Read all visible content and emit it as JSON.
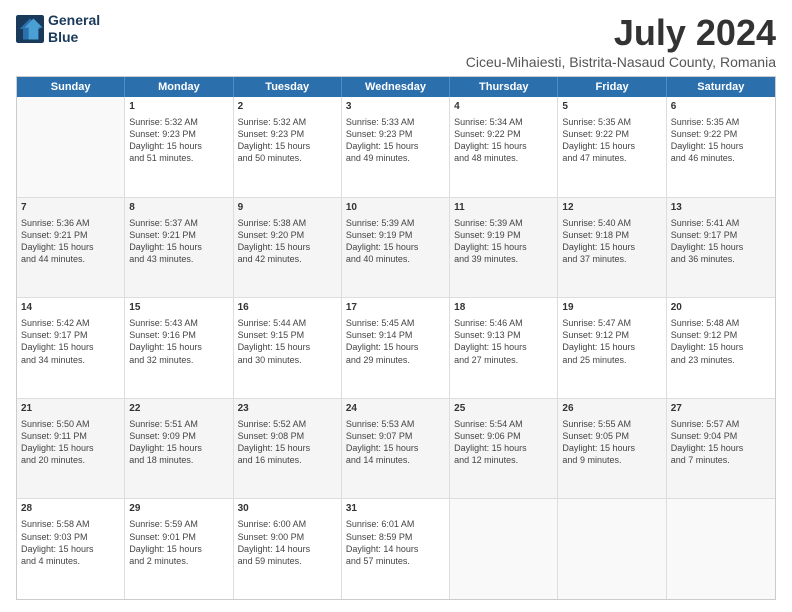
{
  "header": {
    "logo_line1": "General",
    "logo_line2": "Blue",
    "main_title": "July 2024",
    "subtitle": "Ciceu-Mihaiesti, Bistrita-Nasaud County, Romania"
  },
  "weekdays": [
    "Sunday",
    "Monday",
    "Tuesday",
    "Wednesday",
    "Thursday",
    "Friday",
    "Saturday"
  ],
  "rows": [
    [
      {
        "day": "",
        "lines": []
      },
      {
        "day": "1",
        "lines": [
          "Sunrise: 5:32 AM",
          "Sunset: 9:23 PM",
          "Daylight: 15 hours",
          "and 51 minutes."
        ]
      },
      {
        "day": "2",
        "lines": [
          "Sunrise: 5:32 AM",
          "Sunset: 9:23 PM",
          "Daylight: 15 hours",
          "and 50 minutes."
        ]
      },
      {
        "day": "3",
        "lines": [
          "Sunrise: 5:33 AM",
          "Sunset: 9:23 PM",
          "Daylight: 15 hours",
          "and 49 minutes."
        ]
      },
      {
        "day": "4",
        "lines": [
          "Sunrise: 5:34 AM",
          "Sunset: 9:22 PM",
          "Daylight: 15 hours",
          "and 48 minutes."
        ]
      },
      {
        "day": "5",
        "lines": [
          "Sunrise: 5:35 AM",
          "Sunset: 9:22 PM",
          "Daylight: 15 hours",
          "and 47 minutes."
        ]
      },
      {
        "day": "6",
        "lines": [
          "Sunrise: 5:35 AM",
          "Sunset: 9:22 PM",
          "Daylight: 15 hours",
          "and 46 minutes."
        ]
      }
    ],
    [
      {
        "day": "7",
        "lines": [
          "Sunrise: 5:36 AM",
          "Sunset: 9:21 PM",
          "Daylight: 15 hours",
          "and 44 minutes."
        ]
      },
      {
        "day": "8",
        "lines": [
          "Sunrise: 5:37 AM",
          "Sunset: 9:21 PM",
          "Daylight: 15 hours",
          "and 43 minutes."
        ]
      },
      {
        "day": "9",
        "lines": [
          "Sunrise: 5:38 AM",
          "Sunset: 9:20 PM",
          "Daylight: 15 hours",
          "and 42 minutes."
        ]
      },
      {
        "day": "10",
        "lines": [
          "Sunrise: 5:39 AM",
          "Sunset: 9:19 PM",
          "Daylight: 15 hours",
          "and 40 minutes."
        ]
      },
      {
        "day": "11",
        "lines": [
          "Sunrise: 5:39 AM",
          "Sunset: 9:19 PM",
          "Daylight: 15 hours",
          "and 39 minutes."
        ]
      },
      {
        "day": "12",
        "lines": [
          "Sunrise: 5:40 AM",
          "Sunset: 9:18 PM",
          "Daylight: 15 hours",
          "and 37 minutes."
        ]
      },
      {
        "day": "13",
        "lines": [
          "Sunrise: 5:41 AM",
          "Sunset: 9:17 PM",
          "Daylight: 15 hours",
          "and 36 minutes."
        ]
      }
    ],
    [
      {
        "day": "14",
        "lines": [
          "Sunrise: 5:42 AM",
          "Sunset: 9:17 PM",
          "Daylight: 15 hours",
          "and 34 minutes."
        ]
      },
      {
        "day": "15",
        "lines": [
          "Sunrise: 5:43 AM",
          "Sunset: 9:16 PM",
          "Daylight: 15 hours",
          "and 32 minutes."
        ]
      },
      {
        "day": "16",
        "lines": [
          "Sunrise: 5:44 AM",
          "Sunset: 9:15 PM",
          "Daylight: 15 hours",
          "and 30 minutes."
        ]
      },
      {
        "day": "17",
        "lines": [
          "Sunrise: 5:45 AM",
          "Sunset: 9:14 PM",
          "Daylight: 15 hours",
          "and 29 minutes."
        ]
      },
      {
        "day": "18",
        "lines": [
          "Sunrise: 5:46 AM",
          "Sunset: 9:13 PM",
          "Daylight: 15 hours",
          "and 27 minutes."
        ]
      },
      {
        "day": "19",
        "lines": [
          "Sunrise: 5:47 AM",
          "Sunset: 9:12 PM",
          "Daylight: 15 hours",
          "and 25 minutes."
        ]
      },
      {
        "day": "20",
        "lines": [
          "Sunrise: 5:48 AM",
          "Sunset: 9:12 PM",
          "Daylight: 15 hours",
          "and 23 minutes."
        ]
      }
    ],
    [
      {
        "day": "21",
        "lines": [
          "Sunrise: 5:50 AM",
          "Sunset: 9:11 PM",
          "Daylight: 15 hours",
          "and 20 minutes."
        ]
      },
      {
        "day": "22",
        "lines": [
          "Sunrise: 5:51 AM",
          "Sunset: 9:09 PM",
          "Daylight: 15 hours",
          "and 18 minutes."
        ]
      },
      {
        "day": "23",
        "lines": [
          "Sunrise: 5:52 AM",
          "Sunset: 9:08 PM",
          "Daylight: 15 hours",
          "and 16 minutes."
        ]
      },
      {
        "day": "24",
        "lines": [
          "Sunrise: 5:53 AM",
          "Sunset: 9:07 PM",
          "Daylight: 15 hours",
          "and 14 minutes."
        ]
      },
      {
        "day": "25",
        "lines": [
          "Sunrise: 5:54 AM",
          "Sunset: 9:06 PM",
          "Daylight: 15 hours",
          "and 12 minutes."
        ]
      },
      {
        "day": "26",
        "lines": [
          "Sunrise: 5:55 AM",
          "Sunset: 9:05 PM",
          "Daylight: 15 hours",
          "and 9 minutes."
        ]
      },
      {
        "day": "27",
        "lines": [
          "Sunrise: 5:57 AM",
          "Sunset: 9:04 PM",
          "Daylight: 15 hours",
          "and 7 minutes."
        ]
      }
    ],
    [
      {
        "day": "28",
        "lines": [
          "Sunrise: 5:58 AM",
          "Sunset: 9:03 PM",
          "Daylight: 15 hours",
          "and 4 minutes."
        ]
      },
      {
        "day": "29",
        "lines": [
          "Sunrise: 5:59 AM",
          "Sunset: 9:01 PM",
          "Daylight: 15 hours",
          "and 2 minutes."
        ]
      },
      {
        "day": "30",
        "lines": [
          "Sunrise: 6:00 AM",
          "Sunset: 9:00 PM",
          "Daylight: 14 hours",
          "and 59 minutes."
        ]
      },
      {
        "day": "31",
        "lines": [
          "Sunrise: 6:01 AM",
          "Sunset: 8:59 PM",
          "Daylight: 14 hours",
          "and 57 minutes."
        ]
      },
      {
        "day": "",
        "lines": []
      },
      {
        "day": "",
        "lines": []
      },
      {
        "day": "",
        "lines": []
      }
    ]
  ]
}
